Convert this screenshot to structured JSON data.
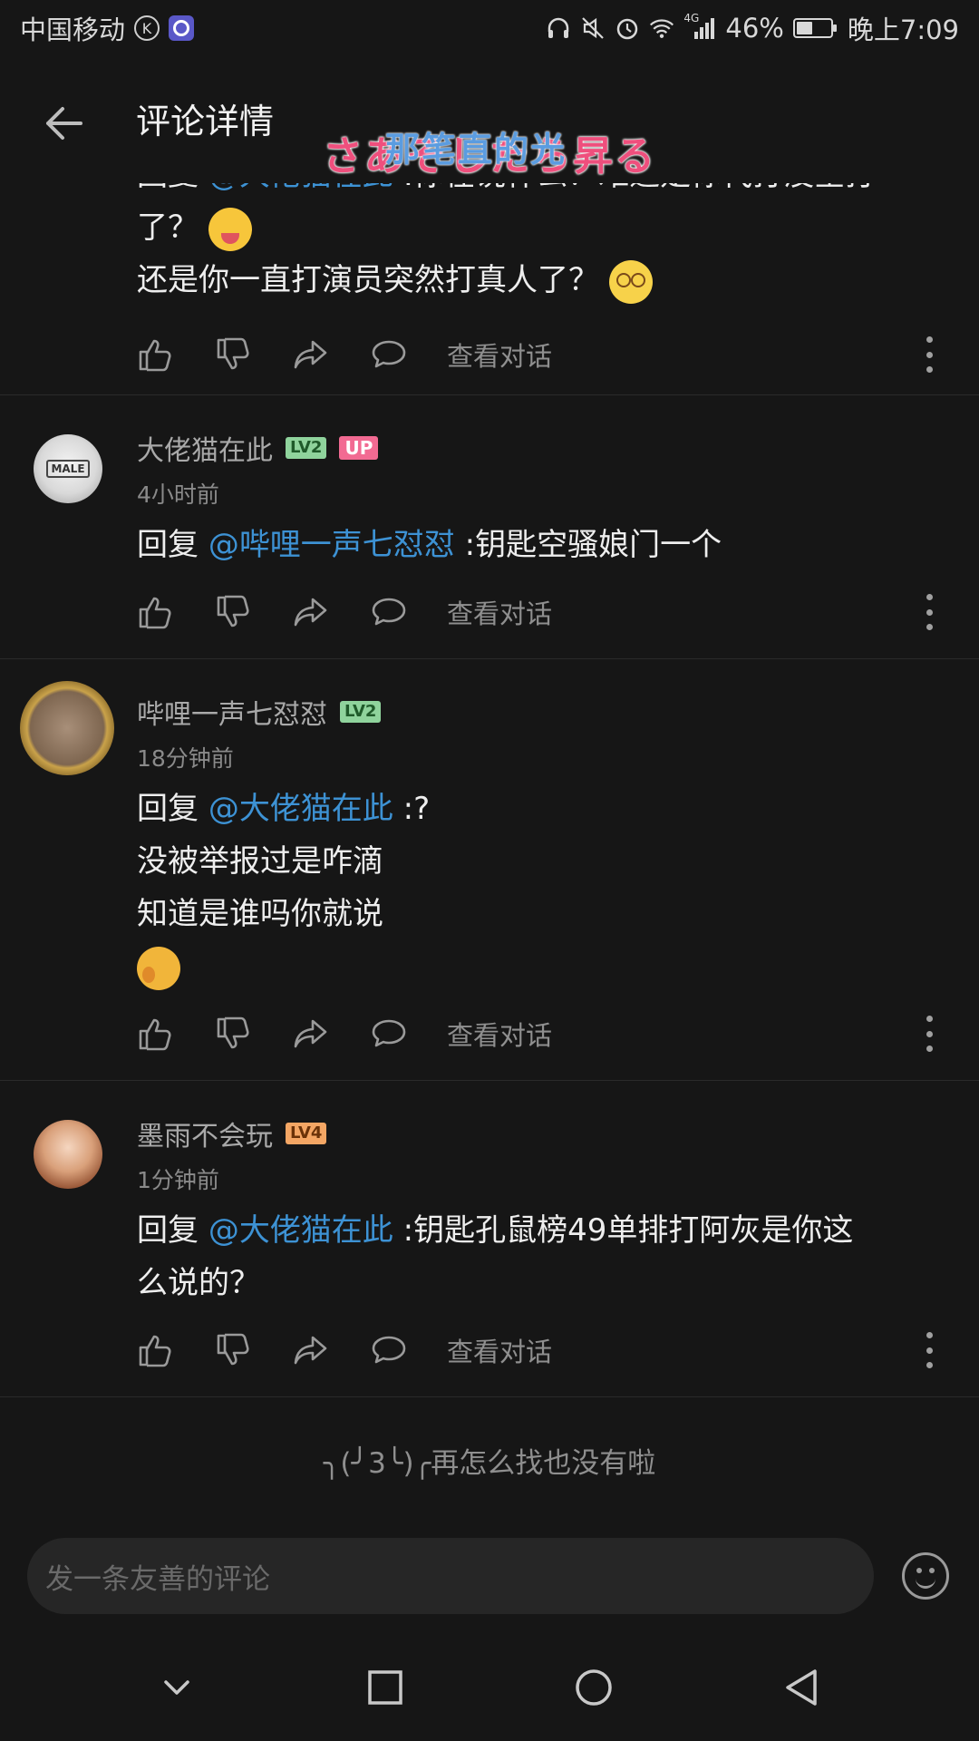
{
  "status_bar": {
    "carrier": "中国移动",
    "badge_k": "K",
    "network": "4G",
    "battery_percent": "46%",
    "battery_level": 0.46,
    "time": "晚上7:09",
    "icons": [
      "headphones-icon",
      "mute-icon",
      "alarm-icon",
      "wifi-icon",
      "signal-icon",
      "battery-icon"
    ]
  },
  "header": {
    "title": "评论详情",
    "back_icon": "arrow-left-icon",
    "overlay_line1": "さあそしたら昇る",
    "overlay_line2": "那笔直的光"
  },
  "comments": [
    {
      "id": "c0",
      "partial": true,
      "lines": [
        {
          "prefix": "回复 ",
          "mention": "@大佬猫在此",
          "text": " :你在说什么？难道是你代打没空打"
        },
        {
          "text": "了？",
          "emoji": "yum-emoji"
        },
        {
          "text": "还是你一直打演员突然打真人了？",
          "emoji": "dizzy-emoji"
        }
      ],
      "view_conversation": "查看对话"
    },
    {
      "id": "c1",
      "username": "大佬猫在此",
      "level": "LV2",
      "up_tag": "UP",
      "avatar_text": "MALE",
      "time": "4小时前",
      "reply_prefix": "回复 ",
      "mention": "@哔哩一声七怼怼",
      "text": " :钥匙空骚娘门一个",
      "view_conversation": "查看对话"
    },
    {
      "id": "c2",
      "username": "哔哩一声七怼怼",
      "level": "LV2",
      "time": "18分钟前",
      "reply_prefix": "回复 ",
      "mention": "@大佬猫在此",
      "text": " :?",
      "line2": "没被举报过是咋滴",
      "line3": "知道是谁吗你就说",
      "emoji": "huff-emoji",
      "view_conversation": "查看对话"
    },
    {
      "id": "c3",
      "username": "墨雨不会玩",
      "level": "LV4",
      "time": "1分钟前",
      "reply_prefix": "回复 ",
      "mention": "@大佬猫在此",
      "text": " :钥匙孔鼠榜49单排打阿灰是你这",
      "line2": "么说的？",
      "view_conversation": "查看对话"
    }
  ],
  "end_text": "╮(╯3╰)╭再怎么找也没有啦",
  "input": {
    "placeholder": "发一条友善的评论",
    "emoji_button_icon": "smiley-icon"
  },
  "nav_bar": [
    "chevron-down-icon",
    "square-icon",
    "circle-icon",
    "triangle-back-icon"
  ],
  "colors": {
    "background": "#161616",
    "mention": "#3d92d4",
    "up_tag": "#f26a92",
    "lv2": "#8fd39c",
    "lv4": "#f4a664",
    "overlay_pink": "#ef4f7d",
    "overlay_blue": "#5b9ce0"
  }
}
